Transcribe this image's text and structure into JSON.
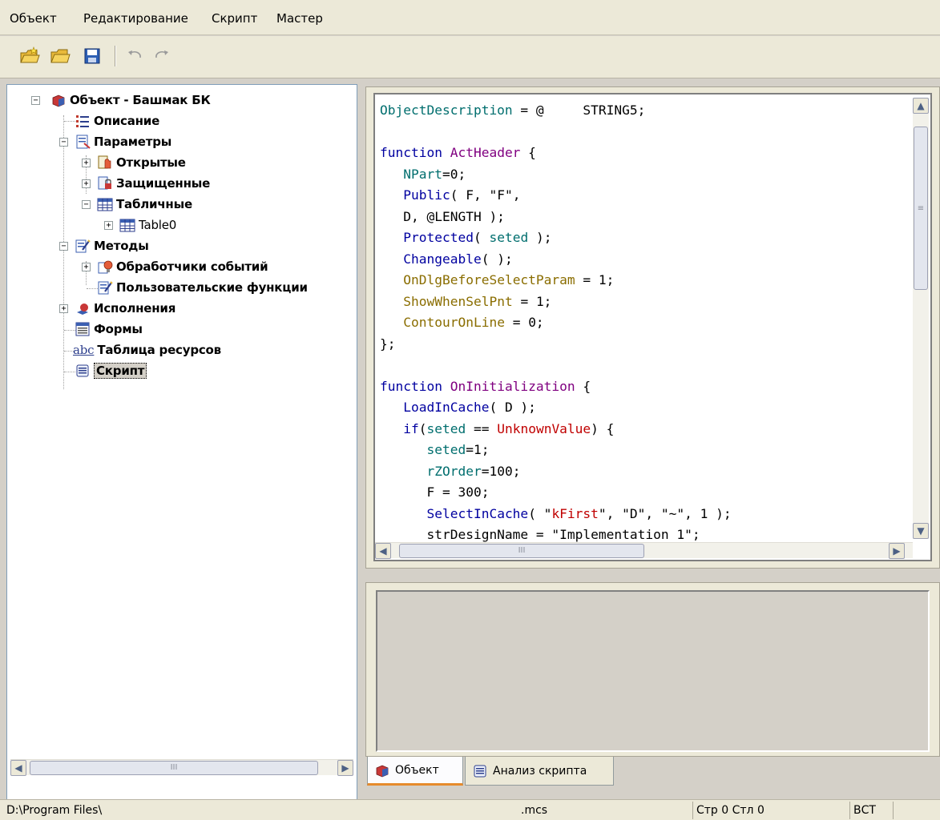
{
  "menu": [
    "Объект",
    "Редактирование",
    "Скрипт",
    "Мастер"
  ],
  "toolbar": {
    "icons": [
      "new-object-icon",
      "open-folder-icon",
      "save-icon",
      "undo-icon",
      "redo-icon"
    ]
  },
  "tree": {
    "root": "Объект - Башмак БК",
    "description": "Описание",
    "parameters": "Параметры",
    "open": "Открытые",
    "protected": "Защищенные",
    "tabular": "Табличные",
    "table0": "Table0",
    "methods": "Методы",
    "event_handlers": "Обработчики событий",
    "user_functions": "Пользовательские функции",
    "executions": "Исполнения",
    "forms": "Формы",
    "resources": "Таблица ресурсов",
    "script": "Скрипт"
  },
  "code_lines": [
    "ObjectDescription = @     STRING5;",
    "",
    "function ActHeader {",
    "   NPart=0;",
    "   Public( F, \"F\",",
    "   D, @LENGTH );",
    "   Protected( seted );",
    "   Changeable( );",
    "   OnDlgBeforeSelectParam = 1;",
    "   ShowWhenSelPnt = 1;",
    "   ContourOnLine = 0;",
    "};",
    "",
    "function OnInitialization {",
    "   LoadInCache( D );",
    "   if(seted == UnknownValue) {",
    "      seted=1;",
    "      rZOrder=100;",
    "      F = 300;",
    "      SelectInCache( \"kFirst\", \"D\", \"~\", 1 );",
    "      strDesignName = \"Implementation 1\";"
  ],
  "tabs": [
    "Объект",
    "Анализ скрипта"
  ],
  "status": {
    "path": "D:\\Program Files\\",
    "ext": ".mcs",
    "position": "Стр 0 Стл 0",
    "mode": "ВСТ"
  },
  "scroll_grip": "III"
}
